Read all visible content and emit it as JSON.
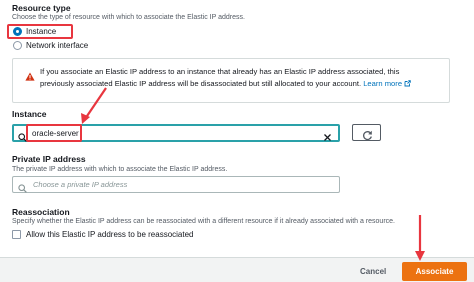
{
  "resource_type": {
    "title": "Resource type",
    "description": "Choose the type of resource with which to associate the Elastic IP address.",
    "options": [
      {
        "label": "Instance",
        "selected": true
      },
      {
        "label": "Network interface",
        "selected": false
      }
    ]
  },
  "alert": {
    "icon": "warning-icon",
    "line1": "If you associate an Elastic IP address to an instance that already has an Elastic IP address associated, this",
    "line2": "previously associated Elastic IP address will be disassociated but still allocated to your account.",
    "link": "Learn more"
  },
  "instance": {
    "title": "Instance",
    "value": "oracle-server"
  },
  "private_ip": {
    "title": "Private IP address",
    "description": "The private IP address with which to associate the Elastic IP address.",
    "placeholder": "Choose a private IP address"
  },
  "reassociation": {
    "title": "Reassociation",
    "description": "Specify whether the Elastic IP address can be reassociated with a different resource if it already associated with a resource.",
    "checkbox_label": "Allow this Elastic IP address to be reassociated",
    "checked": false
  },
  "footer": {
    "cancel_label": "Cancel",
    "associate_label": "Associate"
  },
  "colors": {
    "accent": "#0073bb",
    "primary_button": "#ec7211",
    "highlight": "#e8363f",
    "focus": "#2aa1a9"
  }
}
